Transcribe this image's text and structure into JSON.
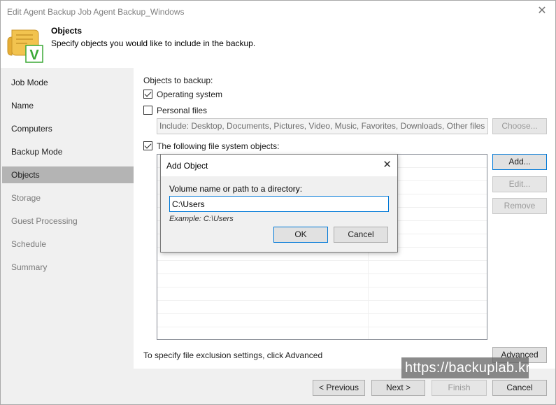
{
  "window": {
    "title": "Edit Agent Backup Job Agent Backup_Windows",
    "close_glyph": "✕"
  },
  "header": {
    "title": "Objects",
    "subtitle": "Specify objects you would like to include in the backup.",
    "logo_icon": "scroll-check-icon",
    "logo_letter": "V",
    "logo_colors": {
      "scroll": "#f2c34f",
      "badge": "#3aa935"
    }
  },
  "sidebar": {
    "items": [
      {
        "label": "Job Mode",
        "state": "normal"
      },
      {
        "label": "Name",
        "state": "normal"
      },
      {
        "label": "Computers",
        "state": "normal"
      },
      {
        "label": "Backup Mode",
        "state": "normal"
      },
      {
        "label": "Objects",
        "state": "active"
      },
      {
        "label": "Storage",
        "state": "disabled"
      },
      {
        "label": "Guest Processing",
        "state": "disabled"
      },
      {
        "label": "Schedule",
        "state": "disabled"
      },
      {
        "label": "Summary",
        "state": "disabled"
      }
    ]
  },
  "main": {
    "objects_label": "Objects to backup:",
    "operating_system": {
      "label": "Operating system",
      "checked": true
    },
    "personal_files": {
      "label": "Personal files",
      "checked": false
    },
    "include_text": "Include: Desktop, Documents, Pictures, Video, Music, Favorites, Downloads, Other files and",
    "choose_button": "Choose...",
    "fs_objects": {
      "label": "The following file system objects:",
      "checked": true
    },
    "add_button": "Add...",
    "edit_button": "Edit...",
    "remove_button": "Remove",
    "exclusion_text": "To specify file exclusion settings, click Advanced",
    "advanced_button": "Advanced"
  },
  "footer": {
    "previous": "< Previous",
    "next": "Next >",
    "finish": "Finish",
    "cancel": "Cancel"
  },
  "dialog": {
    "title": "Add Object",
    "close_glyph": "✕",
    "field_label": "Volume name or path to a directory:",
    "field_value": "C:\\Users",
    "example": "Example: C:\\Users",
    "ok": "OK",
    "cancel": "Cancel"
  },
  "watermark": "https://backuplab.kr"
}
